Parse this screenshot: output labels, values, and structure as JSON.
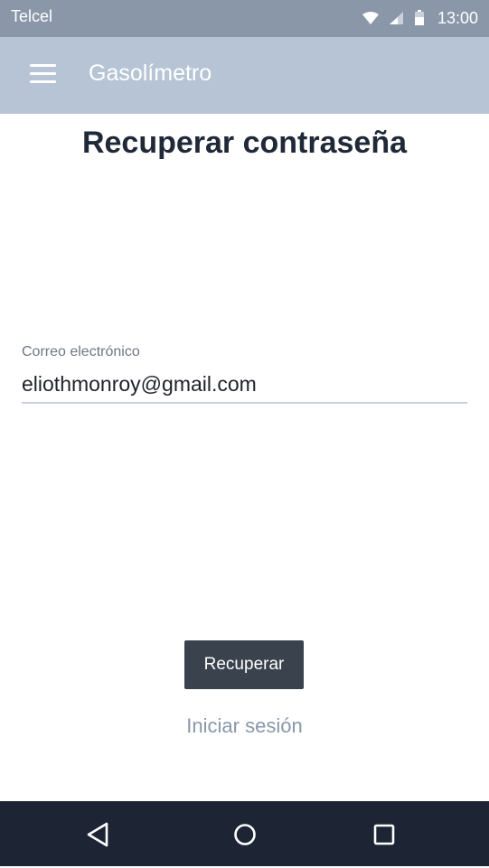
{
  "status_bar": {
    "carrier": "Telcel",
    "time": "13:00",
    "icons": [
      "wifi-icon",
      "signal-icon",
      "battery-icon"
    ]
  },
  "app_bar": {
    "title": "Gasolímetro",
    "menu_icon": "menu-icon"
  },
  "page": {
    "title": "Recuperar contraseña",
    "email_label": "Correo electrónico",
    "email_value": "eliothmonroy@gmail.com",
    "recover_button": "Recuperar",
    "login_link": "Iniciar sesión"
  },
  "nav_bar": {
    "icons": [
      "back-icon",
      "home-icon",
      "recents-icon"
    ]
  },
  "colors": {
    "status_bar": "#8a97a9",
    "app_bar": "#b6c4d5",
    "button": "#3a434d",
    "nav_bar": "#1d2535",
    "link": "#8a97a9"
  }
}
